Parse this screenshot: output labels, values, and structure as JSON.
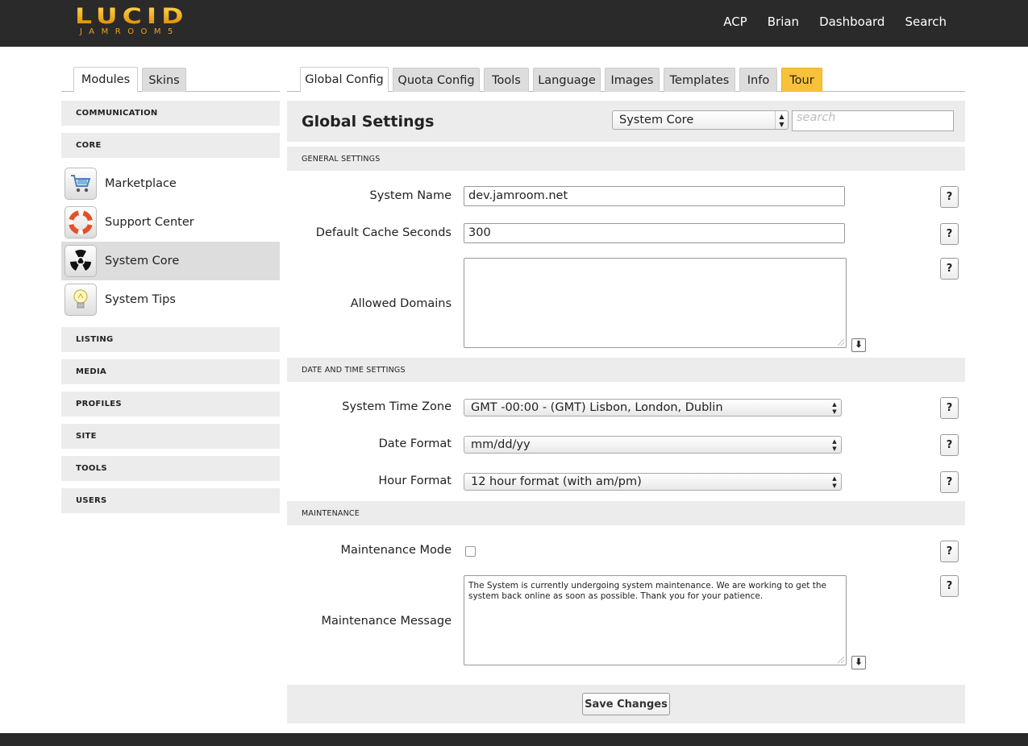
{
  "brand": {
    "name": "LUCID",
    "sub": "JAMROOM5"
  },
  "topnav": [
    "ACP",
    "Brian",
    "Dashboard",
    "Search"
  ],
  "left_tabs": [
    "Modules",
    "Skins"
  ],
  "main_tabs": [
    "Global Config",
    "Quota Config",
    "Tools",
    "Language",
    "Images",
    "Templates",
    "Info",
    "Tour"
  ],
  "sidebar": {
    "sections": [
      "COMMUNICATION",
      "CORE",
      "LISTING",
      "MEDIA",
      "PROFILES",
      "SITE",
      "TOOLS",
      "USERS"
    ],
    "core_items": [
      {
        "label": "Marketplace",
        "icon": "cart-icon"
      },
      {
        "label": "Support Center",
        "icon": "lifebuoy-icon"
      },
      {
        "label": "System Core",
        "icon": "radiation-icon",
        "active": true
      },
      {
        "label": "System Tips",
        "icon": "lightbulb-icon"
      }
    ]
  },
  "main": {
    "title": "Global Settings",
    "module_select": "System Core",
    "search_placeholder": "search",
    "sections": {
      "general": "GENERAL SETTINGS",
      "datetime": "DATE AND TIME SETTINGS",
      "maintenance": "MAINTENANCE"
    },
    "fields": {
      "system_name": {
        "label": "System Name",
        "value": "dev.jamroom.net"
      },
      "cache_seconds": {
        "label": "Default Cache Seconds",
        "value": "300"
      },
      "allowed_domains": {
        "label": "Allowed Domains",
        "value": ""
      },
      "time_zone": {
        "label": "System Time Zone",
        "value": "GMT -00:00 - (GMT) Lisbon, London, Dublin"
      },
      "date_format": {
        "label": "Date Format",
        "value": "mm/dd/yy"
      },
      "hour_format": {
        "label": "Hour Format",
        "value": "12 hour format (with am/pm)"
      },
      "maintenance_mode": {
        "label": "Maintenance Mode",
        "checked": false
      },
      "maintenance_message": {
        "label": "Maintenance Message",
        "value": "The System is currently undergoing system maintenance. We are working to get the system back online as soon as possible. Thank you for your patience."
      }
    },
    "help_label": "?",
    "save_label": "Save Changes"
  }
}
